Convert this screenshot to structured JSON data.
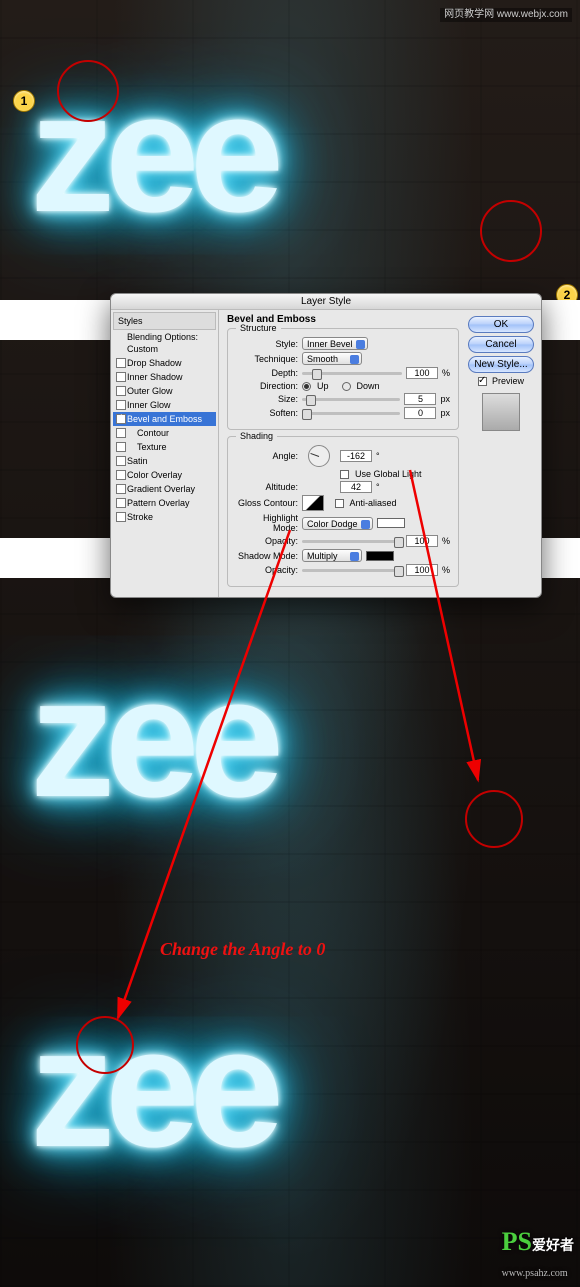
{
  "watermarks": {
    "top": "网页教学网\nwww.webjx.com",
    "bottom_brand": "PS",
    "bottom_text": "爱好者",
    "bottom_url": "www.psahz.com"
  },
  "markers": {
    "one": "1",
    "two": "2"
  },
  "neon_text": "zee",
  "caption": "Change the Angle to 0",
  "dialog": {
    "title": "Layer Style",
    "sidebar": {
      "header": "Styles",
      "blending": "Blending Options: Custom",
      "items": [
        "Drop Shadow",
        "Inner Shadow",
        "Outer Glow",
        "Inner Glow",
        "Bevel and Emboss",
        "Contour",
        "Texture",
        "Satin",
        "Color Overlay",
        "Gradient Overlay",
        "Pattern Overlay",
        "Stroke"
      ]
    },
    "panel_title": "Bevel and Emboss",
    "structure": {
      "legend": "Structure",
      "style_lbl": "Style:",
      "style_val": "Inner Bevel",
      "technique_lbl": "Technique:",
      "technique_val": "Smooth",
      "depth_lbl": "Depth:",
      "depth_val": "100",
      "depth_unit": "%",
      "direction_lbl": "Direction:",
      "up": "Up",
      "down": "Down",
      "size_lbl": "Size:",
      "size_val": "5",
      "size_unit": "px",
      "soften_lbl": "Soften:",
      "soften_val": "0",
      "soften_unit": "px"
    },
    "shading": {
      "legend": "Shading",
      "angle_lbl": "Angle:",
      "angle_val": "-162",
      "angle_deg": "°",
      "global_lbl": "Use Global Light",
      "altitude_lbl": "Altitude:",
      "altitude_val": "42",
      "altitude_deg": "°",
      "gloss_lbl": "Gloss Contour:",
      "aa_lbl": "Anti-aliased",
      "hmode_lbl": "Highlight Mode:",
      "hmode_val": "Color Dodge",
      "hopacity_lbl": "Opacity:",
      "hopacity_val": "100",
      "hopacity_unit": "%",
      "smode_lbl": "Shadow Mode:",
      "smode_val": "Multiply",
      "sopacity_lbl": "Opacity:",
      "sopacity_val": "100",
      "sopacity_unit": "%"
    },
    "buttons": {
      "ok": "OK",
      "cancel": "Cancel",
      "newstyle": "New Style...",
      "preview": "Preview"
    }
  }
}
